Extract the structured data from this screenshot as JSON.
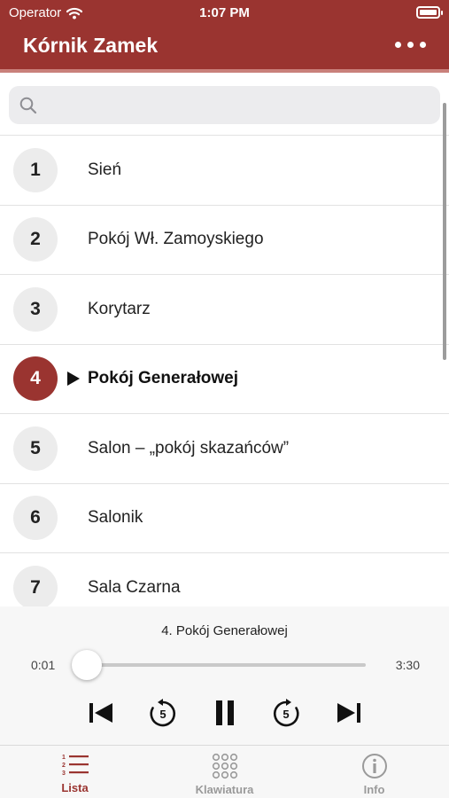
{
  "status_bar": {
    "carrier": "Operator",
    "time": "1:07 PM"
  },
  "header": {
    "title": "Kórnik Zamek",
    "more_icon": "ellipsis-icon"
  },
  "search": {
    "placeholder": "",
    "icon": "search-icon"
  },
  "list": {
    "items": [
      {
        "number": "1",
        "title": "Sień"
      },
      {
        "number": "2",
        "title": "Pokój Wł. Zamoyskiego"
      },
      {
        "number": "3",
        "title": "Korytarz"
      },
      {
        "number": "4",
        "title": "Pokój Generałowej"
      },
      {
        "number": "5",
        "title": "Salon – „pokój skazańców”"
      },
      {
        "number": "6",
        "title": "Salonik"
      },
      {
        "number": "7",
        "title": "Sala Czarna"
      }
    ],
    "active_index": 3
  },
  "player": {
    "now_playing": "4. Pokój Generałowej",
    "elapsed": "0:01",
    "duration": "3:30",
    "progress": 0.005,
    "rewind_seconds": "5",
    "forward_seconds": "5"
  },
  "tabs": [
    {
      "label": "Lista",
      "icon": "numbered-list-icon",
      "active": true
    },
    {
      "label": "Klawiatura",
      "icon": "keypad-icon",
      "active": false
    },
    {
      "label": "Info",
      "icon": "info-icon",
      "active": false
    }
  ],
  "colors": {
    "brand": "#9a3430",
    "inactive": "#9a9a9a"
  }
}
